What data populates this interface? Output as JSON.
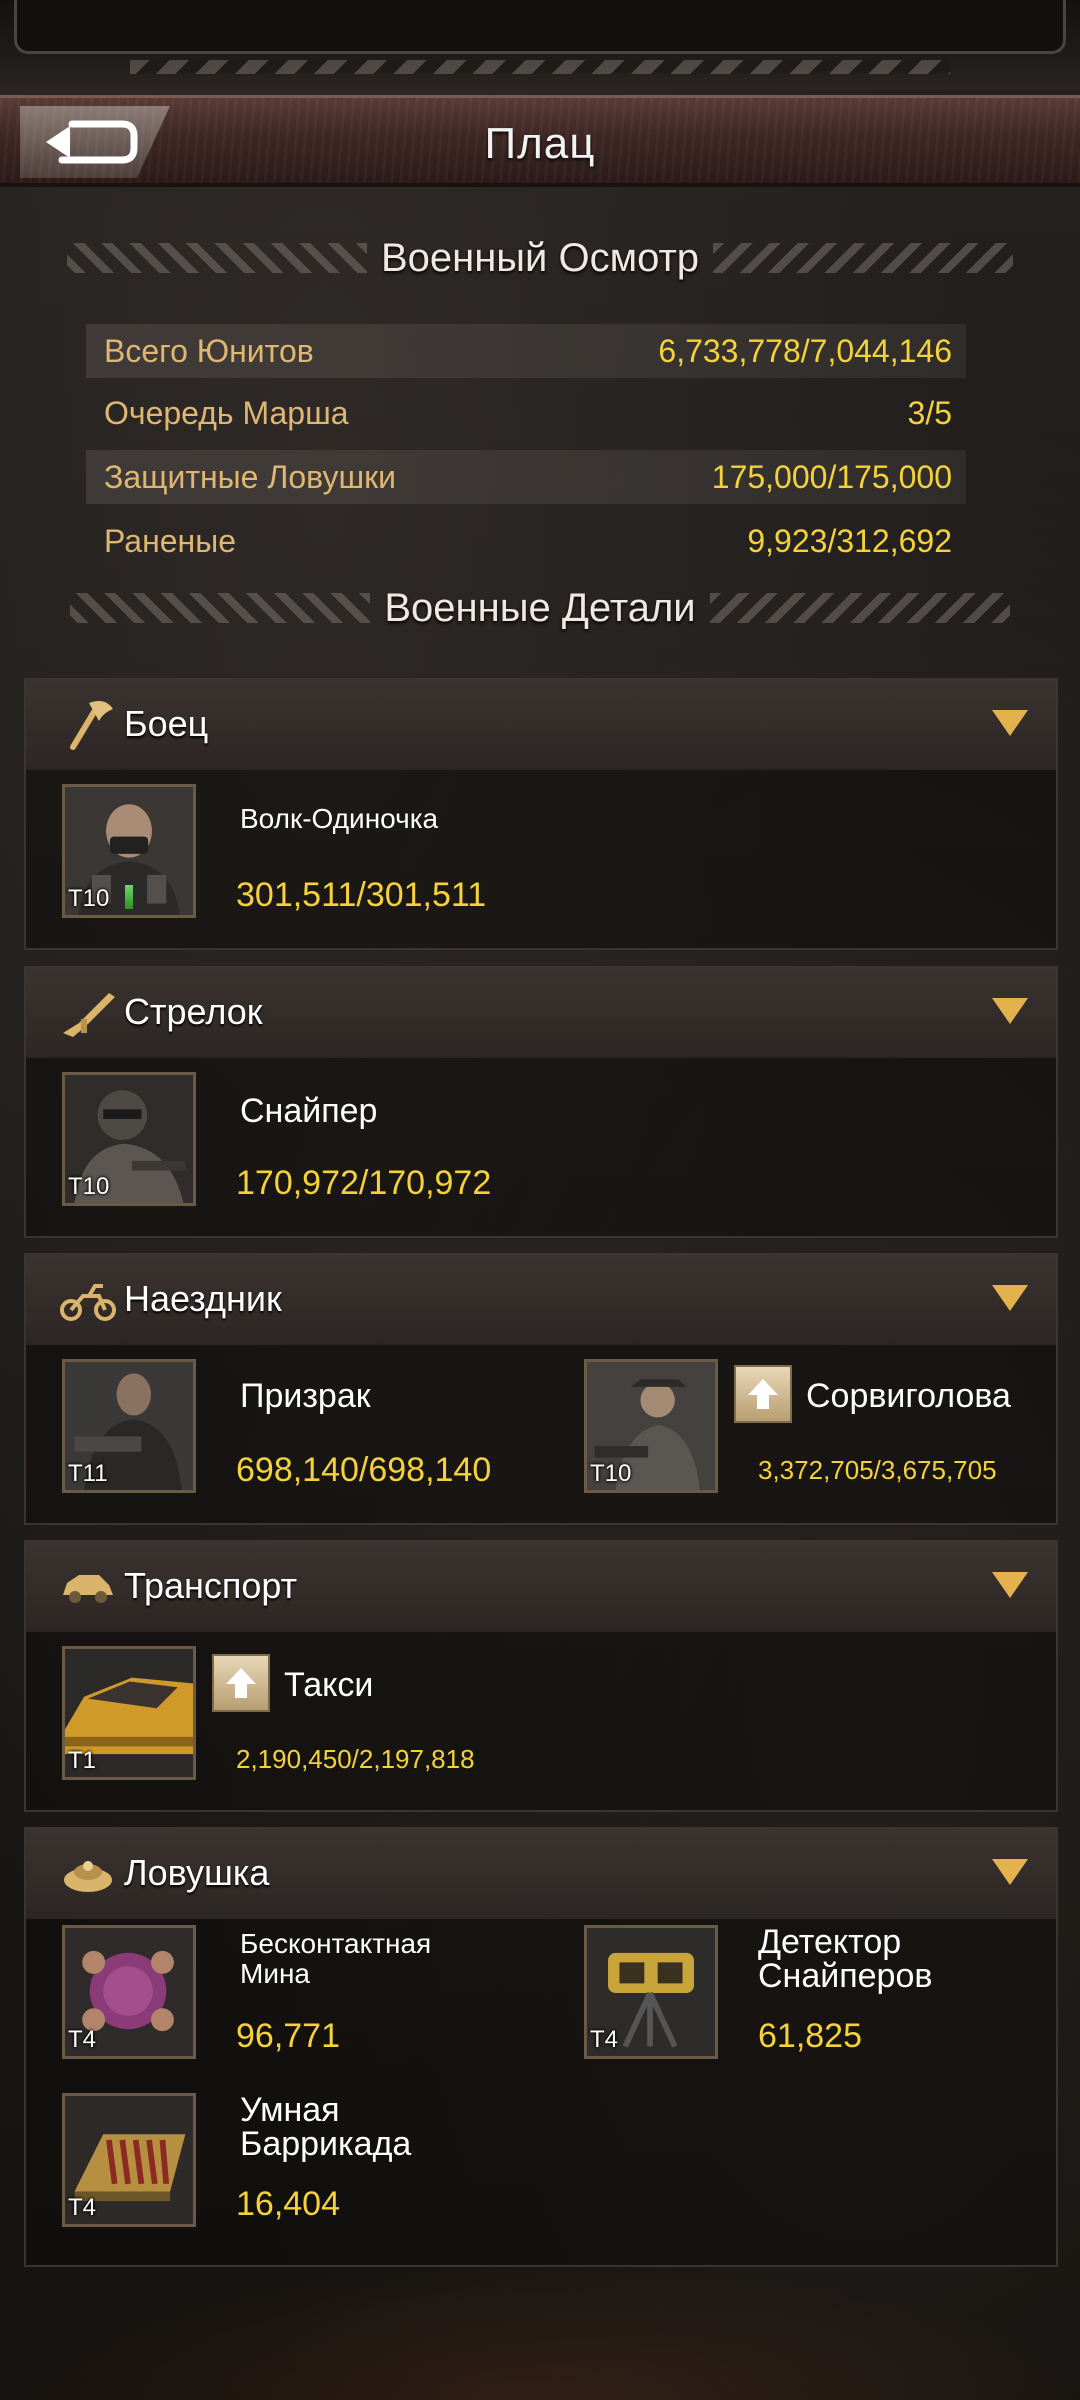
{
  "header": {
    "title": "Плац"
  },
  "overview": {
    "title": "Военный Осмотр",
    "stats": [
      {
        "label": "Всего Юнитов",
        "value": "6,733,778/7,044,146"
      },
      {
        "label": "Очередь Марша",
        "value": "3/5"
      },
      {
        "label": "Защитные Ловушки",
        "value": "175,000/175,000"
      },
      {
        "label": "Раненые",
        "value": "9,923/312,692"
      }
    ]
  },
  "details": {
    "title": "Военные Детали",
    "categories": [
      {
        "name": "Боец",
        "icon": "axe-icon",
        "units": [
          {
            "name": "Волк-Одиночка",
            "tier": "T10",
            "count": "301,511/301,511"
          }
        ]
      },
      {
        "name": "Стрелок",
        "icon": "rifle-icon",
        "units": [
          {
            "name": "Снайпер",
            "tier": "T10",
            "count": "170,972/170,972"
          }
        ]
      },
      {
        "name": "Наездник",
        "icon": "motorcycle-icon",
        "units": [
          {
            "name": "Призрак",
            "tier": "T11",
            "count": "698,140/698,140"
          },
          {
            "name": "Сорвиголова",
            "tier": "T10",
            "count": "3,372,705/3,675,705",
            "upgrade": true
          }
        ]
      },
      {
        "name": "Транспорт",
        "icon": "car-icon",
        "units": [
          {
            "name": "Такси",
            "tier": "T1",
            "count": "2,190,450/2,197,818",
            "upgrade": true
          }
        ]
      },
      {
        "name": "Ловушка",
        "icon": "mine-icon",
        "units": [
          {
            "name": "Бесконтактная Мина",
            "name_line1": "Бесконтактная",
            "name_line2": "Мина",
            "tier": "T4",
            "count": "96,771"
          },
          {
            "name": "Детектор Снайперов",
            "name_line1": "Детектор",
            "name_line2": "Снайперов",
            "tier": "T4",
            "count": "61,825"
          },
          {
            "name": "Умная Баррикада",
            "name_line1": "Умная",
            "name_line2": "Баррикада",
            "tier": "T4",
            "count": "16,404"
          }
        ]
      }
    ]
  },
  "colors": {
    "accent_gold": "#f5d23a",
    "label_tan": "#e0b772",
    "chevron": "#e3b24c"
  }
}
